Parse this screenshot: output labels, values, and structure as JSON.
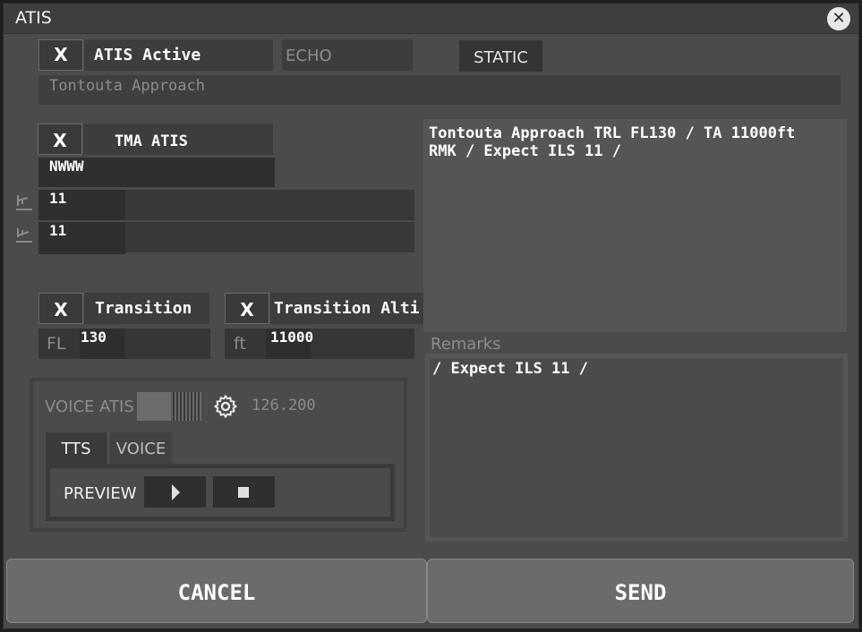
{
  "window": {
    "title": "ATIS"
  },
  "top": {
    "atis_active_check": "X",
    "atis_active_label": "ATIS Active",
    "echo_label": "ECHO",
    "static_label": "STATIC",
    "station_name": "Tontouta Approach"
  },
  "tma": {
    "check": "X",
    "label": "TMA ATIS",
    "code": "NWWW",
    "arrival_runway": "11",
    "departure_runway": "11"
  },
  "transition": {
    "level_check": "X",
    "level_label": "Transition",
    "level_prefix": "FL",
    "level_value": "130",
    "alt_check": "X",
    "alt_label": "Transition Alti",
    "alt_prefix": "ft",
    "alt_value": "11000"
  },
  "voice": {
    "label": "VOICE ATIS",
    "frequency": "126.200",
    "tab_tts": "TTS",
    "tab_voice": "VOICE",
    "preview_label": "PREVIEW"
  },
  "preview_text": {
    "line1": "Tontouta Approach TRL FL130 / TA 11000ft",
    "line2": "RMK / Expect ILS 11 /"
  },
  "remarks": {
    "label": "Remarks",
    "value": "/ Expect ILS 11 /"
  },
  "footer": {
    "cancel_label": "CANCEL",
    "send_label": "SEND"
  }
}
